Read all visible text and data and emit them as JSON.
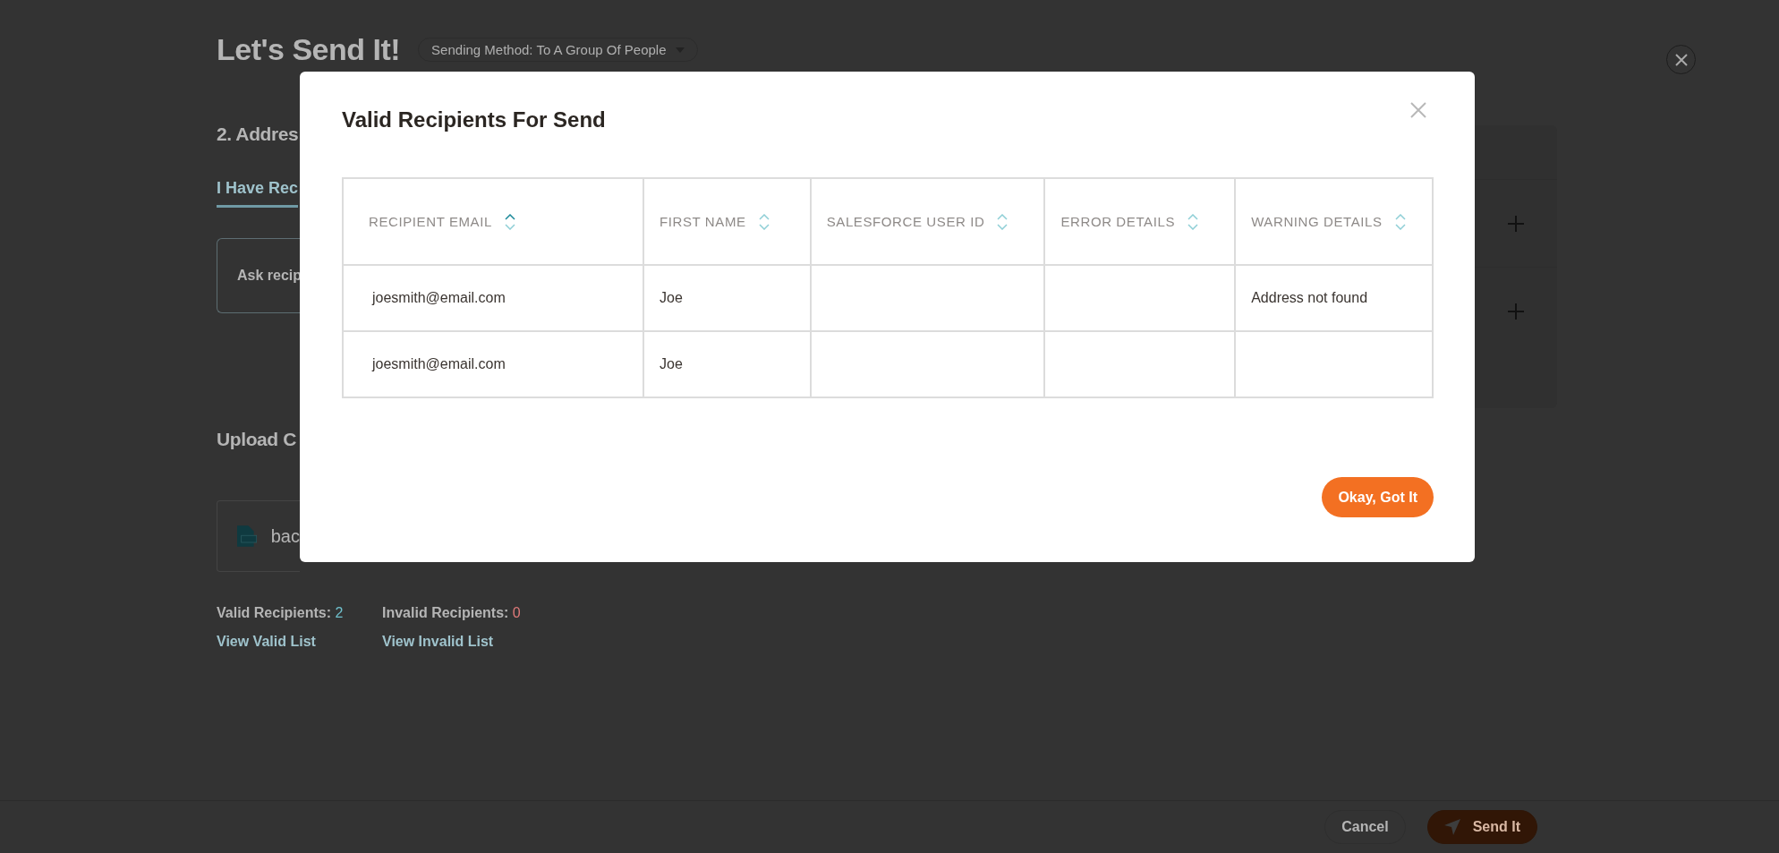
{
  "page": {
    "title": "Let's Send It!",
    "method_dropdown": "Sending Method: To A Group Of People",
    "section_heading": "2. Addres",
    "tab": {
      "label": "I Have Rec",
      "selected": true
    },
    "option_card": "Ask recip",
    "upload_heading": "Upload C",
    "file_name": "bac",
    "valid_label": "Valid Recipients:",
    "valid_count": "2",
    "invalid_label": "Invalid Recipients:",
    "invalid_count": "0",
    "valid_link": "View Valid List",
    "invalid_link": "View Invalid List",
    "footer_buttons": [
      {
        "label": "Cancel",
        "kind": "secondary"
      },
      {
        "label": "Send It",
        "kind": "primary"
      }
    ]
  },
  "modal": {
    "title": "Valid Recipients For Send",
    "columns": [
      {
        "label": "RECIPIENT EMAIL",
        "sorted": true
      },
      {
        "label": "FIRST NAME",
        "sorted": false
      },
      {
        "label": "SALESFORCE USER ID",
        "sorted": false
      },
      {
        "label": "ERROR DETAILS",
        "sorted": false
      },
      {
        "label": "WARNING DETAILS",
        "sorted": false
      }
    ],
    "rows": [
      [
        "joesmith@email.com",
        "Joe",
        null,
        null,
        "Address not found"
      ],
      [
        "joesmith@email.com",
        "Joe",
        null,
        null,
        null
      ]
    ],
    "button": "Okay, Got It"
  }
}
